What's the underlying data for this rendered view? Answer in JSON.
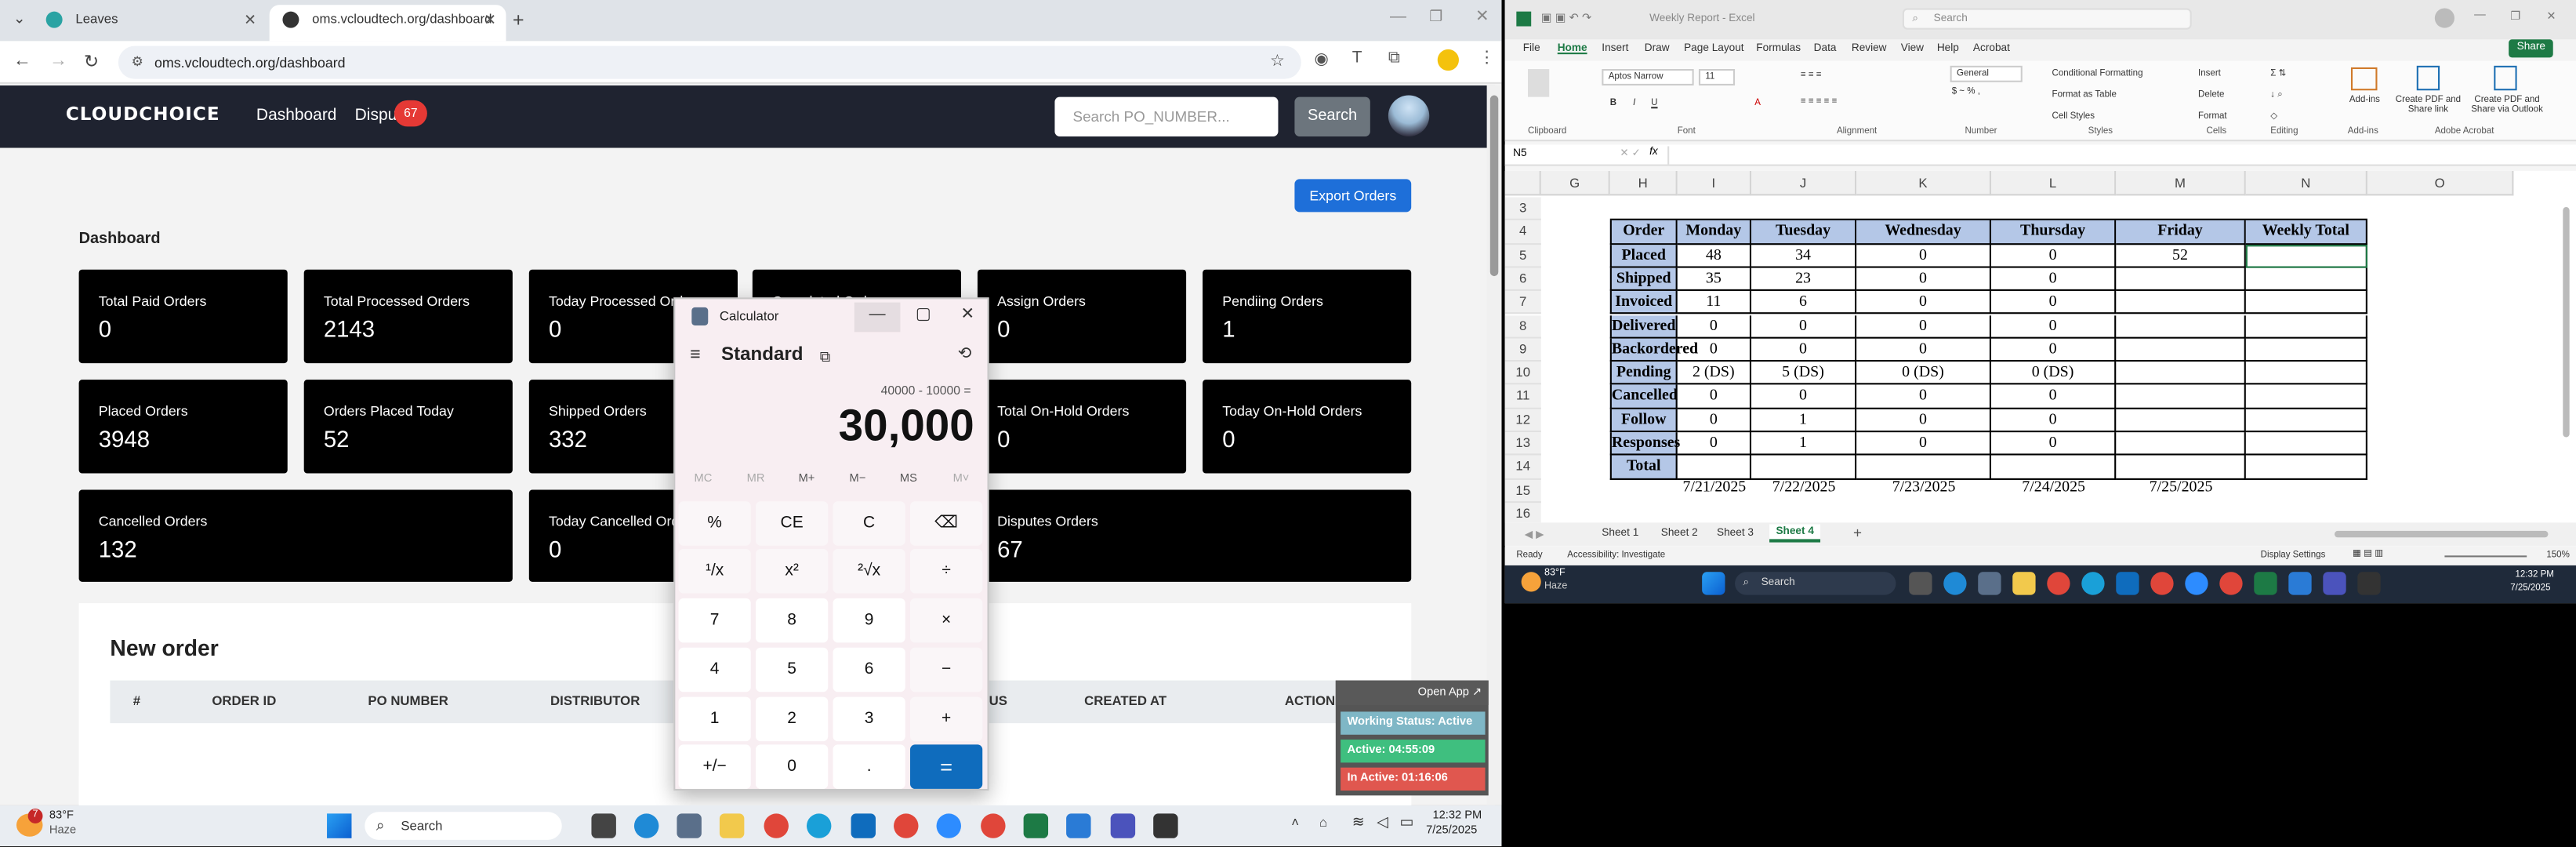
{
  "browser": {
    "tabs": [
      {
        "title": "Leaves"
      },
      {
        "title": "oms.vcloudtech.org/dashboard"
      }
    ],
    "url": "oms.vcloudtech.org/dashboard"
  },
  "site": {
    "logo": "CLOUDCHOICE",
    "nav": {
      "dashboard": "Dashboard",
      "disputes": "Dispu",
      "disputes_badge": "67"
    },
    "search": {
      "placeholder": "Search PO_NUMBER...",
      "button": "Search"
    },
    "export_button": "Export Orders",
    "dashboard_title": "Dashboard",
    "cards": [
      {
        "label": "Total Paid Orders",
        "value": "0"
      },
      {
        "label": "Total Processed Orders",
        "value": "2143"
      },
      {
        "label": "Today Processed Orders",
        "value": "0"
      },
      {
        "label": "Completed Orders",
        "value": ""
      },
      {
        "label": "Assign Orders",
        "value": "0"
      },
      {
        "label": "Pendiing Orders",
        "value": "1"
      },
      {
        "label": "Placed Orders",
        "value": "3948"
      },
      {
        "label": "Orders Placed Today",
        "value": "52"
      },
      {
        "label": "Shipped Orders",
        "value": "332"
      },
      {
        "label": "Total On-Hold Orders",
        "value": "0"
      },
      {
        "label": "Today On-Hold Orders",
        "value": "0"
      },
      {
        "label": "Cancelled Orders",
        "value": "132"
      },
      {
        "label": "Today Cancelled Orders",
        "value": "0"
      },
      {
        "label": "Disputes Orders",
        "value": "67"
      }
    ],
    "new_order": {
      "title": "New order",
      "columns": [
        "#",
        "ORDER ID",
        "PO NUMBER",
        "DISTRIBUTOR",
        "US",
        "CREATED AT",
        "ACTION"
      ]
    }
  },
  "calculator": {
    "title": "Calculator",
    "mode": "Standard",
    "expression": "40000 - 10000 =",
    "result": "30,000",
    "memory": [
      "MC",
      "MR",
      "M+",
      "M−",
      "MS",
      "M˅"
    ],
    "keys": [
      [
        "%",
        "CE",
        "C",
        "⌫"
      ],
      [
        "¹/x",
        "x²",
        "²√x",
        "÷"
      ],
      [
        "7",
        "8",
        "9",
        "×"
      ],
      [
        "4",
        "5",
        "6",
        "−"
      ],
      [
        "1",
        "2",
        "3",
        "+"
      ],
      [
        "+/−",
        "0",
        ".",
        "="
      ]
    ]
  },
  "widget": {
    "open_app": "Open App ↗",
    "status": "Working Status: Active",
    "active": "Active: 04:55:09",
    "inactive": "In Active: 01:16:06"
  },
  "excel": {
    "title": "Weekly Report - Excel",
    "search_placeholder": "Search",
    "menu": [
      "File",
      "Home",
      "Insert",
      "Draw",
      "Page Layout",
      "Formulas",
      "Data",
      "Review",
      "View",
      "Help",
      "Acrobat"
    ],
    "share": "Share",
    "font_name": "Aptos Narrow",
    "font_size": "11",
    "number_format": "General",
    "ribbon": {
      "conditional": "Conditional Formatting",
      "format_table": "Format as Table",
      "cell_styles": "Cell Styles",
      "insert": "Insert",
      "delete": "Delete",
      "format": "Format",
      "addins": "Add-ins",
      "create_pdf_share": "Create PDF and Share link",
      "create_pdf_outlook": "Create PDF and Share via Outlook",
      "groups": [
        "Clipboard",
        "Font",
        "Alignment",
        "Number",
        "Styles",
        "Cells",
        "Editing",
        "Add-ins",
        "Adobe Acrobat"
      ]
    },
    "name_box": "N5",
    "columns": [
      "G",
      "H",
      "I",
      "J",
      "K",
      "L",
      "M",
      "N",
      "O"
    ],
    "rows": [
      "3",
      "4",
      "5",
      "6",
      "7",
      "8",
      "9",
      "10",
      "11",
      "12",
      "13",
      "14",
      "15",
      "16"
    ],
    "table": {
      "headers": [
        "Order Status",
        "Monday",
        "Tuesday",
        "Wednesday",
        "Thursday",
        "Friday",
        "Weekly Total"
      ],
      "rows": [
        [
          "Placed",
          "48",
          "34",
          "0",
          "0",
          "52",
          ""
        ],
        [
          "Shipped",
          "35",
          "23",
          "0",
          "0",
          "",
          ""
        ],
        [
          "Invoiced",
          "11",
          "6",
          "0",
          "0",
          "",
          ""
        ],
        [
          "Delivered",
          "0",
          "0",
          "0",
          "0",
          "",
          ""
        ],
        [
          "Backordered",
          "0",
          "0",
          "0",
          "0",
          "",
          ""
        ],
        [
          "Pending",
          "2 (DS)",
          "5 (DS)",
          "0 (DS)",
          "0 (DS)",
          "",
          ""
        ],
        [
          "Cancelled",
          "0",
          "0",
          "0",
          "0",
          "",
          ""
        ],
        [
          "Follow Ups",
          "0",
          "1",
          "0",
          "0",
          "",
          ""
        ],
        [
          "Responses",
          "0",
          "1",
          "0",
          "0",
          "",
          ""
        ],
        [
          "Total",
          "",
          "",
          "",
          "",
          "",
          ""
        ]
      ],
      "dates": [
        "7/21/2025",
        "7/22/2025",
        "7/23/2025",
        "7/24/2025",
        "7/25/2025"
      ]
    },
    "sheets": [
      "Sheet 1",
      "Sheet 2",
      "Sheet 3",
      "Sheet 4"
    ],
    "status": {
      "ready": "Ready",
      "accessibility": "Accessibility: Investigate",
      "display": "Display Settings",
      "zoom": "150%"
    },
    "taskbar": {
      "temp": "83°F",
      "weather": "Haze",
      "search": "Search",
      "time": "12:32 PM",
      "date": "7/25/2025"
    }
  },
  "taskbar": {
    "temp": "83°F",
    "weather": "Haze",
    "search": "Search",
    "time": "12:32 PM",
    "date": "7/25/2025",
    "notif": "7"
  }
}
